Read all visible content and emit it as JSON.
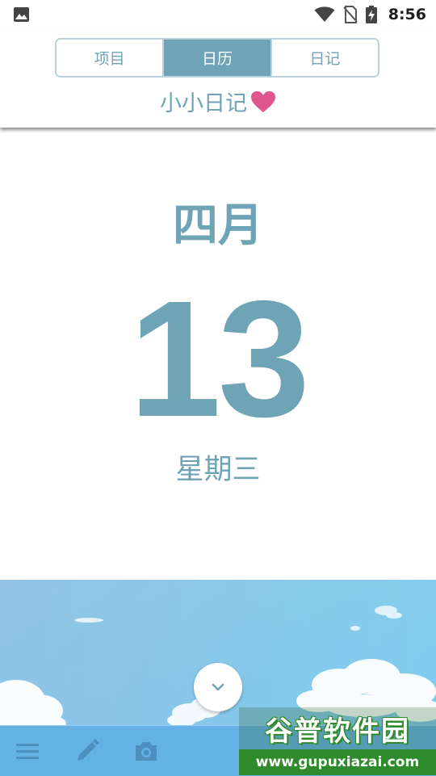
{
  "status_bar": {
    "time": "8:56",
    "left_icon": "image-icon",
    "right_icons": [
      "wifi-icon",
      "no-sim-icon",
      "battery-charging-icon"
    ]
  },
  "header": {
    "tabs": [
      {
        "label": "项目",
        "active": false
      },
      {
        "label": "日历",
        "active": true
      },
      {
        "label": "日记",
        "active": false
      }
    ],
    "app_title": "小小日记",
    "title_icon": "heart-icon"
  },
  "date": {
    "month": "四月",
    "day": "13",
    "weekday": "星期三"
  },
  "collapse_button": {
    "icon": "chevron-down-icon"
  },
  "toolbar": {
    "icons": [
      "menu-icon",
      "pencil-icon",
      "camera-icon"
    ]
  },
  "watermark": {
    "title": "谷普软件园",
    "url": "www.gupuxiazai.com"
  },
  "colors": {
    "accent": "#6fa3b6",
    "heart": "#e0558e",
    "toolbar": "#64b1e6",
    "watermark_green": "#2f8a2c"
  }
}
